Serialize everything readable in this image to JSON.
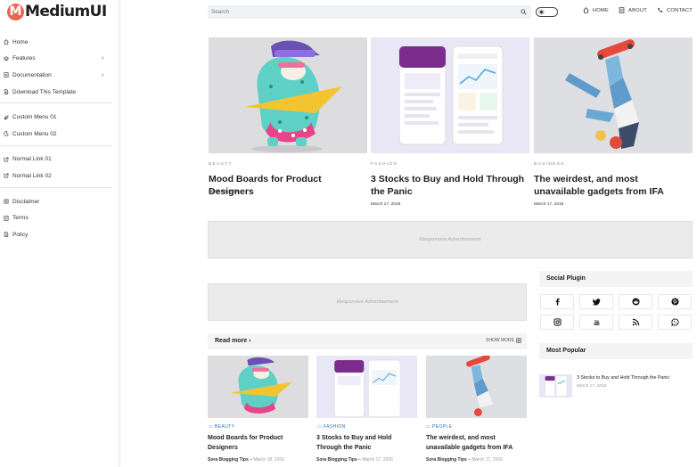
{
  "brand": {
    "logo_letter": "M",
    "logo_text": "MediumUI",
    "accent": "#e8674a"
  },
  "sidebar": {
    "groups": [
      [
        {
          "label": "Home",
          "icon": "home-icon",
          "chevron": false
        },
        {
          "label": "Features",
          "icon": "layers-icon",
          "chevron": true
        },
        {
          "label": "Documentation",
          "icon": "doc-icon",
          "chevron": true
        },
        {
          "label": "Download This Template",
          "icon": "download-icon",
          "chevron": false
        }
      ],
      [
        {
          "label": "Custom Menu 01",
          "icon": "leaf-icon",
          "chevron": false
        },
        {
          "label": "Custom Menu 02",
          "icon": "moon-icon",
          "chevron": false
        }
      ],
      [
        {
          "label": "Normal Link 01",
          "icon": "external-link-icon",
          "chevron": false
        },
        {
          "label": "Normal Link 02",
          "icon": "external-link-icon",
          "chevron": false
        }
      ],
      [
        {
          "label": "Disclaimer",
          "icon": "list-icon",
          "chevron": false
        },
        {
          "label": "Terms",
          "icon": "doc-icon",
          "chevron": false
        },
        {
          "label": "Policy",
          "icon": "doc-icon",
          "chevron": false
        }
      ]
    ]
  },
  "search": {
    "placeholder": "Search"
  },
  "topnav": [
    {
      "label": "HOME",
      "icon": "home-icon"
    },
    {
      "label": "ABOUT",
      "icon": "doc-icon"
    },
    {
      "label": "CONTACT",
      "icon": "phone-icon"
    }
  ],
  "featured": [
    {
      "category": "BEAUTY",
      "title": "Mood Boards for Product Designers",
      "date": "March 18, 2016"
    },
    {
      "category": "FASHION",
      "title": "3 Stocks to Buy and Hold Through the Panic",
      "date": "March 17, 2016"
    },
    {
      "category": "BUSINESS",
      "title": "The weirdest, and most unavailable gadgets from IFA",
      "date": "March 17, 2016"
    }
  ],
  "ads": {
    "top": "Responsive Advertisement",
    "middle": "Responsive Advertisement"
  },
  "read_more": {
    "title": "Read more",
    "arrow": "›",
    "show_more": "SHOW MORE",
    "posts": [
      {
        "category": "BEAUTY",
        "title": "Mood Boards for Product Designers",
        "author": "Sora Blogging Tips",
        "date": "March 18, 2016"
      },
      {
        "category": "FASHION",
        "title": "3 Stocks to Buy and Hold Through the Panic",
        "author": "Sora Blogging Tips",
        "date": "March 17, 2016"
      },
      {
        "category": "PEOPLE",
        "title": "The weirdest, and most unavailable gadgets from IFA",
        "author": "Sora Blogging Tips",
        "date": "March 17, 2016"
      }
    ]
  },
  "social": {
    "title": "Social Plugin",
    "icons": [
      "facebook-icon",
      "twitter-icon",
      "reddit-icon",
      "pinterest-icon",
      "instagram-icon",
      "youtube-icon",
      "rss-icon",
      "whatsapp-icon"
    ]
  },
  "popular": {
    "title": "Most Popular",
    "items": [
      {
        "title": "3 Stocks to Buy and Hold Through the Panic",
        "date": "March 17, 2016"
      }
    ]
  },
  "carousel": {
    "prev": "‹",
    "next": "›"
  }
}
